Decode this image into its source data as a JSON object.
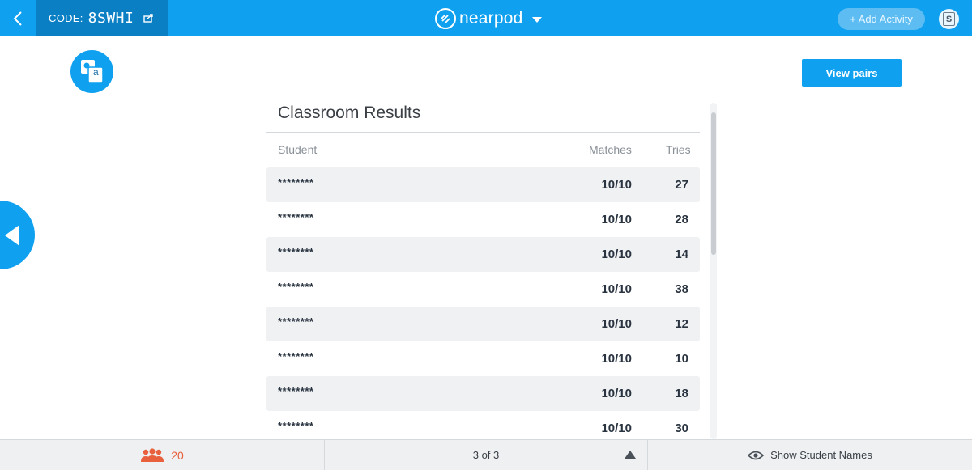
{
  "topbar": {
    "code_label": "CODE:",
    "code_value": "8SWHI",
    "logo_text": "nearpod",
    "add_activity_label": "+ Add Activity",
    "profile_initial": "S"
  },
  "activity": {
    "icon_letter": "a",
    "view_pairs_label": "View pairs"
  },
  "results": {
    "title": "Classroom Results",
    "columns": {
      "student": "Student",
      "matches": "Matches",
      "tries": "Tries"
    },
    "rows": [
      {
        "student": "********",
        "matches": "10/10",
        "tries": "27"
      },
      {
        "student": "********",
        "matches": "10/10",
        "tries": "28"
      },
      {
        "student": "********",
        "matches": "10/10",
        "tries": "14"
      },
      {
        "student": "********",
        "matches": "10/10",
        "tries": "38"
      },
      {
        "student": "********",
        "matches": "10/10",
        "tries": "12"
      },
      {
        "student": "********",
        "matches": "10/10",
        "tries": "10"
      },
      {
        "student": "********",
        "matches": "10/10",
        "tries": "18"
      },
      {
        "student": "********",
        "matches": "10/10",
        "tries": "30"
      }
    ]
  },
  "bottombar": {
    "student_count": "20",
    "page_indicator": "3 of 3",
    "show_names_label": "Show Student Names"
  },
  "colors": {
    "brand_blue": "#0fa0ef",
    "code_bg": "#0b7fc4",
    "student_count": "#e8603c"
  }
}
